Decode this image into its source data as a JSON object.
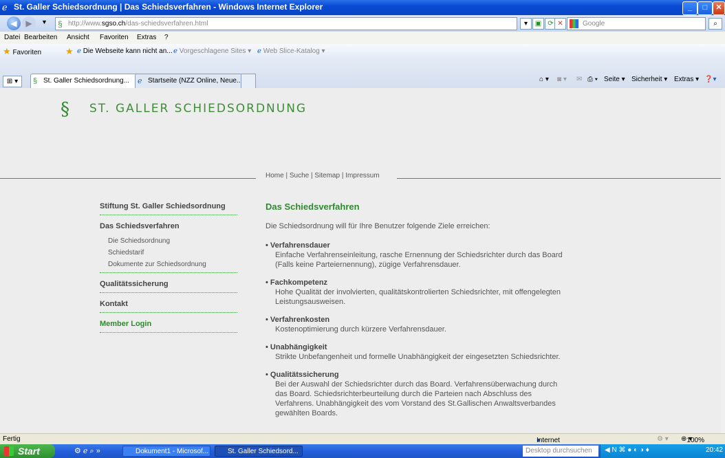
{
  "window": {
    "title": "St. Galler Schiedsordnung | Das Schiedsverfahren - Windows Internet Explorer"
  },
  "address": {
    "url_prefix": "http://www.",
    "url_domain": "sgso.ch",
    "url_path": "/das-schiedsverfahren.html",
    "search_placeholder": "Google"
  },
  "menu": [
    "Datei",
    "Bearbeiten",
    "Ansicht",
    "Favoriten",
    "Extras",
    "?"
  ],
  "favorites": {
    "label": "Favoriten",
    "items": [
      "Die Webseite kann nicht an...",
      "Vorgeschlagene Sites ▾",
      "Web Slice-Katalog ▾"
    ]
  },
  "tabs": [
    "St. Galler Schiedsordnung...",
    "Startseite (NZZ Online, Neue..."
  ],
  "tools": [
    "Seite ▾",
    "Sicherheit ▾",
    "Extras ▾"
  ],
  "site": {
    "logo_text": "ST. GALLER SCHIEDSORDNUNG",
    "topnav": [
      "Home",
      "Suche",
      "Sitemap",
      "Impressum"
    ],
    "sidebar": {
      "items": [
        "Stiftung St. Galler Schiedsordnung",
        "Das Schiedsverfahren"
      ],
      "subitems": [
        "Die Schiedsordnung",
        "Schiedstarif",
        "Dokumente zur Schiedsordnung"
      ],
      "items2": [
        "Qualitätssicherung",
        "Kontakt",
        "Member Login"
      ]
    },
    "content": {
      "title": "Das Schiedsverfahren",
      "intro": "Die Schiedsordnung will für Ihre Benutzer folgende Ziele erreichen:",
      "bullets": [
        {
          "title": "Verfahrensdauer",
          "text": "Einfache Verfahrenseinleitung, rasche Ernennung der Schiedsrichter durch das Board (Falls keine Parteiernennung), zügige Verfahrensdauer."
        },
        {
          "title": "Fachkompetenz",
          "text": "Hohe Qualität der involvierten, qualitätskontrolierten Schiedsrichter, mit offengelegten Leistungsausweisen."
        },
        {
          "title": "Verfahrenkosten",
          "text": "Kostenoptimierung durch kürzere Verfahrensdauer."
        },
        {
          "title": "Unabhängigkeit",
          "text": "Strikte Unbefangenheit und formelle Unabhängigkeit der eingesetzten Schiedsrichter."
        },
        {
          "title": "Qualitätssicherung",
          "text": "Bei der Auswahl der Schiedsrichter durch das Board. Verfahrensüberwachung durch das Board. Schiedsrichterbeurteilung durch die Parteien nach Abschluss des Verfahrens. Unabhängigkeit des vom Vorstand des St.Gallischen Anwaltsverbandes gewählten Boards."
        }
      ]
    }
  },
  "status": {
    "left": "Fertig",
    "zone": "Internet",
    "zoom": "100%"
  },
  "taskbar": {
    "start": "Start",
    "items": [
      "Dokument1 - Microsof...",
      "St. Galler Schiedsord..."
    ],
    "search": "Desktop durchsuchen",
    "time": "20:42"
  },
  "colors": {
    "brand_green": "#2f8a2f",
    "title_blue": "#0a4bd6"
  }
}
